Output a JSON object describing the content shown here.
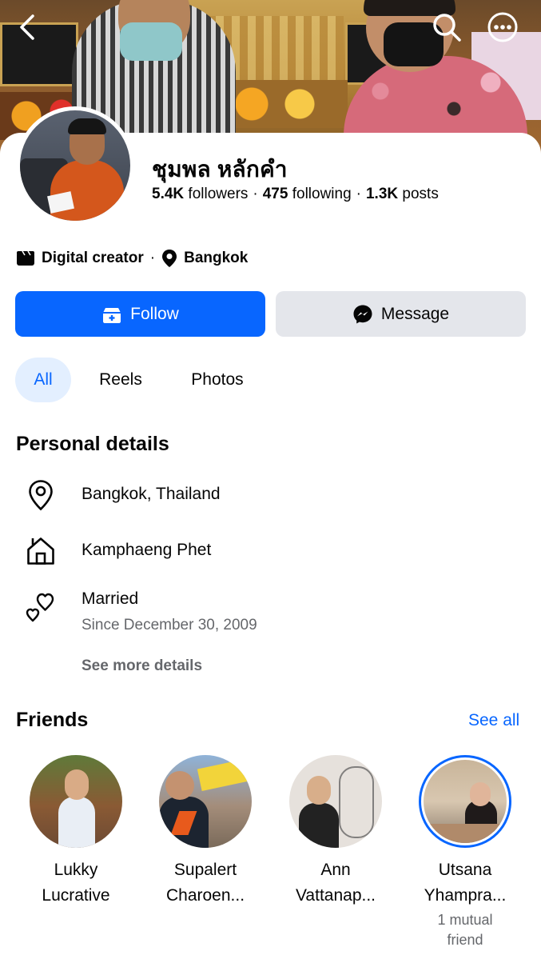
{
  "profile": {
    "name": "ชุมพล หลักคำ",
    "followers_count": "5.4K",
    "followers_label": "followers",
    "following_count": "475",
    "following_label": "following",
    "posts_count": "1.3K",
    "posts_label": "posts",
    "category": "Digital creator",
    "location": "Bangkok"
  },
  "actions": {
    "follow_label": "Follow",
    "message_label": "Message"
  },
  "tabs": [
    {
      "label": "All",
      "active": true
    },
    {
      "label": "Reels",
      "active": false
    },
    {
      "label": "Photos",
      "active": false
    }
  ],
  "personal_details": {
    "title": "Personal details",
    "items": [
      {
        "icon": "location-pin-icon",
        "text": "Bangkok, Thailand"
      },
      {
        "icon": "home-icon",
        "text": "Kamphaeng Phet"
      },
      {
        "icon": "hearts-icon",
        "text": "Married",
        "sub": "Since December 30, 2009"
      }
    ],
    "see_more_label": "See more details"
  },
  "friends": {
    "title": "Friends",
    "see_all_label": "See all",
    "items": [
      {
        "name_line1": "Lukky",
        "name_line2": "Lucrative"
      },
      {
        "name_line1": "Supalert",
        "name_line2": "Charoen..."
      },
      {
        "name_line1": "Ann",
        "name_line2": "Vattanap..."
      },
      {
        "name_line1": "Utsana",
        "name_line2": "Yhampra...",
        "mutual_line1": "1 mutual",
        "mutual_line2": "friend",
        "has_story": true
      }
    ]
  },
  "colors": {
    "accent": "#0866ff",
    "secondary_button": "#e4e6eb",
    "active_tab_bg": "#e3efff",
    "muted_text": "#65676b"
  }
}
